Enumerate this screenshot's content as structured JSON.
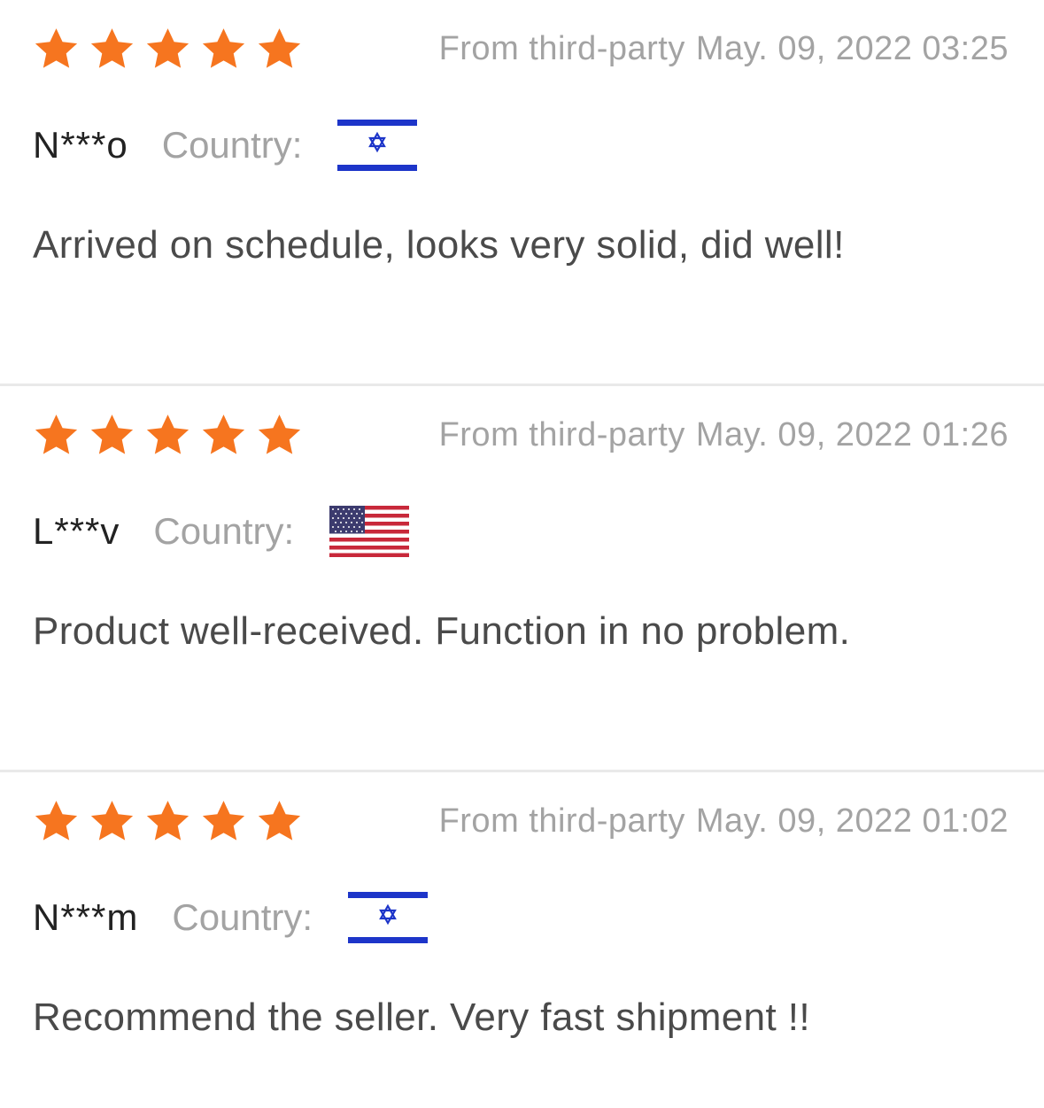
{
  "colors": {
    "star": "#f6751f",
    "meta_text": "#a3a3a3",
    "comment_text": "#4a4a4a",
    "divider": "#e9e9e9"
  },
  "reviews": [
    {
      "rating": 5,
      "source": "From third-party",
      "date": "May. 09, 2022 03:25",
      "user": "N***o",
      "country_label": "Country:",
      "flag_icon": "israel-flag-icon",
      "comment": "Arrived on schedule, looks very solid, did well!"
    },
    {
      "rating": 5,
      "source": "From third-party",
      "date": "May. 09, 2022 01:26",
      "user": "L***v",
      "country_label": "Country:",
      "flag_icon": "usa-flag-icon",
      "comment": "Product well-received. Function in no problem."
    },
    {
      "rating": 5,
      "source": "From third-party",
      "date": "May. 09, 2022 01:02",
      "user": "N***m",
      "country_label": "Country:",
      "flag_icon": "israel-flag-icon",
      "comment": "Recommend the seller. Very fast shipment !!"
    }
  ]
}
